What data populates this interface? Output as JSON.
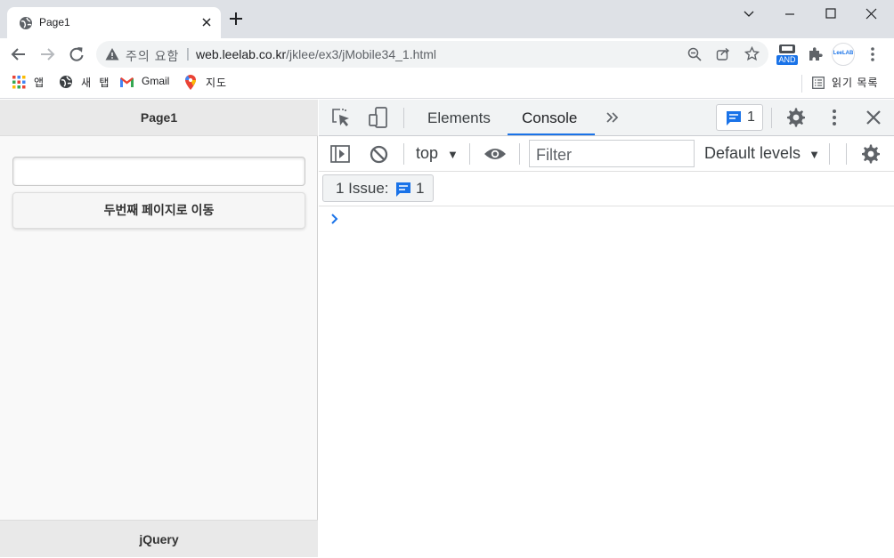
{
  "browser": {
    "tab": {
      "title": "Page1"
    },
    "toolbar": {
      "security_label": "주의 요함",
      "url_host": "web.leelab.co.kr",
      "url_path": "/jklee/ex3/jMobile34_1.html"
    },
    "extensions": {
      "and_badge": "AND",
      "leelab_label": "LeeLAB"
    },
    "bookmarks": {
      "items": [
        {
          "label": "앱",
          "icon": "apps-grid-icon"
        },
        {
          "label": "새 탭",
          "icon": "globe-icon"
        },
        {
          "label": "Gmail",
          "icon": "gmail-icon"
        },
        {
          "label": "지도",
          "icon": "maps-pin-icon"
        }
      ],
      "reading_list": "읽기 목록"
    }
  },
  "page": {
    "header_title": "Page1",
    "input_value": "",
    "button_label": "두번째 페이지로 이동",
    "footer_title": "jQuery"
  },
  "devtools": {
    "tabs": [
      {
        "label": "Elements",
        "active": false
      },
      {
        "label": "Console",
        "active": true
      }
    ],
    "issues_badge_count": "1",
    "context": "top",
    "filter_placeholder": "Filter",
    "levels": "Default levels",
    "issue_chip": {
      "label": "1 Issue:",
      "count": "1"
    },
    "accent_color": "#1a73e8"
  }
}
